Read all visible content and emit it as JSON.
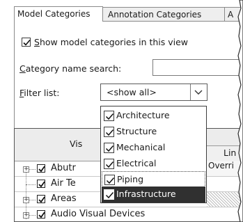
{
  "tabs": [
    {
      "label": "Model Categories",
      "active": true
    },
    {
      "label": "Annotation Categories",
      "active": false
    },
    {
      "label": "A",
      "active": false
    }
  ],
  "show_model_categories": {
    "label": "Show model categories in this view",
    "checked": true
  },
  "category_search": {
    "label": "Category name search:",
    "value": ""
  },
  "filter_list": {
    "label": "Filter list:",
    "selected": "<show all>"
  },
  "grid": {
    "header_visibility": "Vis",
    "header_lines": "Lin",
    "header_overrides": "Overri",
    "rows": [
      {
        "label": "Abutr",
        "checked": true,
        "expandable": true
      },
      {
        "label": "Air Te",
        "checked": true,
        "expandable": false
      },
      {
        "label": "Areas",
        "checked": true,
        "expandable": true
      },
      {
        "label": "Audio Visual Devices",
        "checked": true,
        "expandable": true
      }
    ]
  },
  "dropdown_items": [
    {
      "label": "Architecture",
      "checked": true,
      "focused": false,
      "selected": false
    },
    {
      "label": "Structure",
      "checked": true,
      "focused": false,
      "selected": false
    },
    {
      "label": "Mechanical",
      "checked": true,
      "focused": false,
      "selected": false
    },
    {
      "label": "Electrical",
      "checked": true,
      "focused": false,
      "selected": false
    },
    {
      "label": "Piping",
      "checked": true,
      "focused": true,
      "selected": false
    },
    {
      "label": "Infrastructure",
      "checked": true,
      "focused": false,
      "selected": true
    }
  ],
  "icons": {
    "checkbox": "check-icon",
    "dropdown": "chevron-down-icon",
    "tree_expand": "plus-box-icon"
  }
}
